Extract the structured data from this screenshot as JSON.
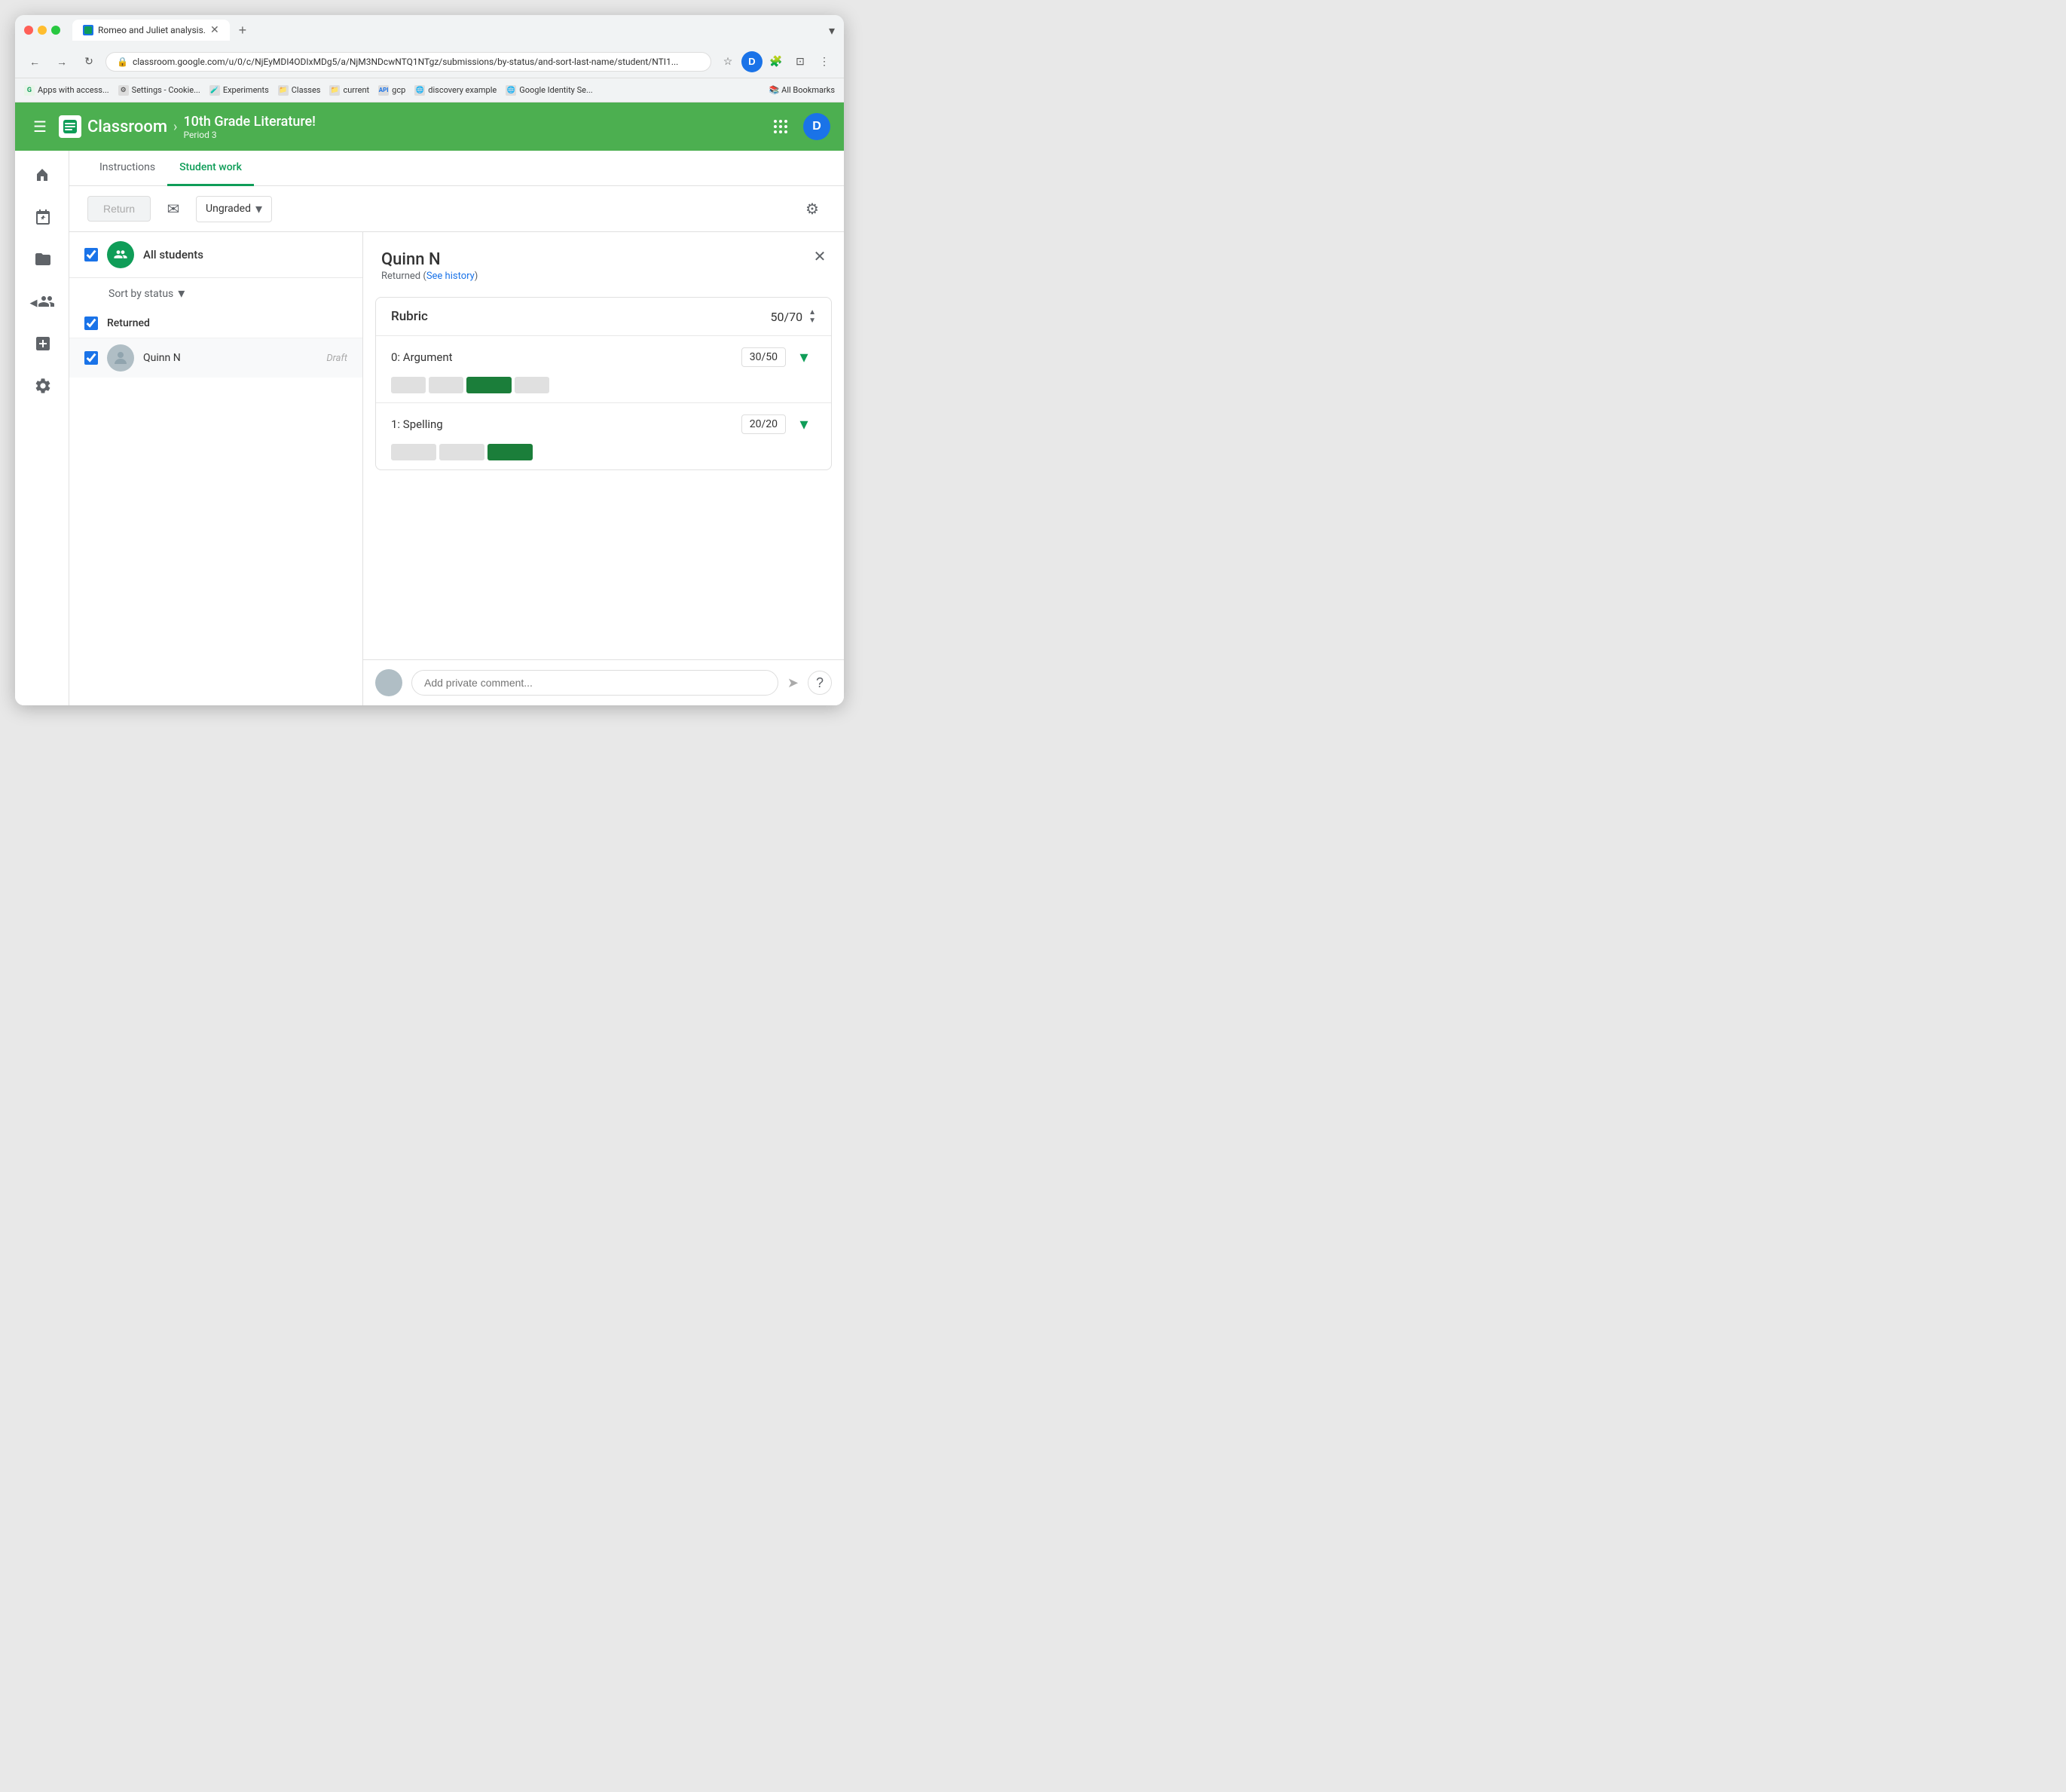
{
  "browser": {
    "tab_title": "Romeo and Juliet analysis.",
    "url": "classroom.google.com/u/0/c/NjEyMDI4ODIxMDg5/a/NjM3NDcwNTQ1NTgz/submissions/by-status/and-sort-last-name/student/NTI1...",
    "bookmarks": [
      {
        "label": "Apps with access...",
        "icon": "G"
      },
      {
        "label": "Settings - Cookie...",
        "icon": "⚙"
      },
      {
        "label": "Experiments",
        "icon": "🧪"
      },
      {
        "label": "Classes",
        "icon": "📁"
      },
      {
        "label": "current",
        "icon": "📁"
      },
      {
        "label": "gcp",
        "icon": "API"
      },
      {
        "label": "discovery example",
        "icon": "🌐"
      },
      {
        "label": "Google Identity Se...",
        "icon": "🌐"
      },
      {
        "label": "All Bookmarks",
        "icon": "📚"
      }
    ],
    "new_tab_icon": "+"
  },
  "header": {
    "app_name": "Classroom",
    "course_title": "10th Grade Literature!",
    "course_period": "Period 3",
    "avatar_letter": "D"
  },
  "tabs": [
    {
      "label": "Instructions",
      "active": false
    },
    {
      "label": "Student work",
      "active": true
    }
  ],
  "toolbar": {
    "return_label": "Return",
    "grade_label": "Ungraded"
  },
  "student_list": {
    "all_students_label": "All students",
    "sort_label": "Sort by status",
    "section_label": "Returned",
    "students": [
      {
        "name": "Quinn N",
        "status": "Draft",
        "selected": true
      }
    ]
  },
  "student_detail": {
    "name": "Quinn N",
    "status": "Returned (See history)",
    "rubric_title": "Rubric",
    "rubric_score": "50",
    "rubric_total": "70",
    "criteria": [
      {
        "name": "0: Argument",
        "score": "30",
        "total": "50",
        "bars": [
          {
            "width": 46,
            "selected": false
          },
          {
            "width": 46,
            "selected": false
          },
          {
            "width": 60,
            "selected": true
          },
          {
            "width": 46,
            "selected": false
          }
        ]
      },
      {
        "name": "1: Spelling",
        "score": "20",
        "total": "20",
        "bars": [
          {
            "width": 60,
            "selected": false
          },
          {
            "width": 60,
            "selected": false
          },
          {
            "width": 60,
            "selected": true
          }
        ]
      }
    ]
  },
  "comment": {
    "placeholder": "Add private comment..."
  },
  "icons": {
    "hamburger": "☰",
    "back": "←",
    "forward": "→",
    "refresh": "↻",
    "lock": "🔒",
    "star": "☆",
    "extensions": "🧩",
    "sidebar_toggle": "⊡",
    "more": "⋮",
    "grid": "⋮⋮⋮",
    "home": "🏠",
    "calendar": "📅",
    "folder": "📁",
    "add": "➕",
    "settings": "⚙",
    "people": "👥",
    "expand_left": "◀",
    "email": "✉",
    "gear": "⚙",
    "close": "✕",
    "chevron_down": "▾",
    "chevron_up": "▴",
    "expand_more": "▾",
    "send": "➤",
    "help": "?"
  }
}
